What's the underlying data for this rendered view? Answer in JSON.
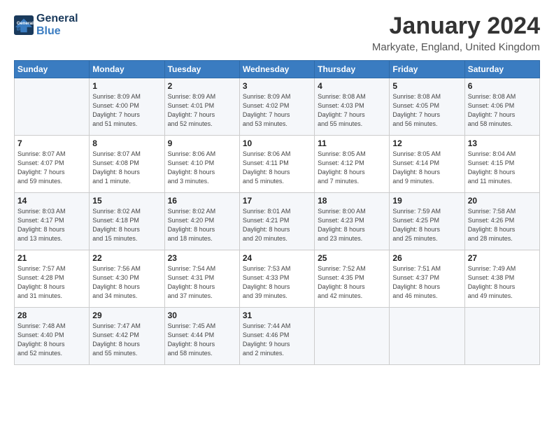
{
  "header": {
    "logo_line1": "General",
    "logo_line2": "Blue",
    "title": "January 2024",
    "location": "Markyate, England, United Kingdom"
  },
  "days_of_week": [
    "Sunday",
    "Monday",
    "Tuesday",
    "Wednesday",
    "Thursday",
    "Friday",
    "Saturday"
  ],
  "weeks": [
    [
      {
        "day": "",
        "info": ""
      },
      {
        "day": "1",
        "info": "Sunrise: 8:09 AM\nSunset: 4:00 PM\nDaylight: 7 hours\nand 51 minutes."
      },
      {
        "day": "2",
        "info": "Sunrise: 8:09 AM\nSunset: 4:01 PM\nDaylight: 7 hours\nand 52 minutes."
      },
      {
        "day": "3",
        "info": "Sunrise: 8:09 AM\nSunset: 4:02 PM\nDaylight: 7 hours\nand 53 minutes."
      },
      {
        "day": "4",
        "info": "Sunrise: 8:08 AM\nSunset: 4:03 PM\nDaylight: 7 hours\nand 55 minutes."
      },
      {
        "day": "5",
        "info": "Sunrise: 8:08 AM\nSunset: 4:05 PM\nDaylight: 7 hours\nand 56 minutes."
      },
      {
        "day": "6",
        "info": "Sunrise: 8:08 AM\nSunset: 4:06 PM\nDaylight: 7 hours\nand 58 minutes."
      }
    ],
    [
      {
        "day": "7",
        "info": "Sunrise: 8:07 AM\nSunset: 4:07 PM\nDaylight: 7 hours\nand 59 minutes."
      },
      {
        "day": "8",
        "info": "Sunrise: 8:07 AM\nSunset: 4:08 PM\nDaylight: 8 hours\nand 1 minute."
      },
      {
        "day": "9",
        "info": "Sunrise: 8:06 AM\nSunset: 4:10 PM\nDaylight: 8 hours\nand 3 minutes."
      },
      {
        "day": "10",
        "info": "Sunrise: 8:06 AM\nSunset: 4:11 PM\nDaylight: 8 hours\nand 5 minutes."
      },
      {
        "day": "11",
        "info": "Sunrise: 8:05 AM\nSunset: 4:12 PM\nDaylight: 8 hours\nand 7 minutes."
      },
      {
        "day": "12",
        "info": "Sunrise: 8:05 AM\nSunset: 4:14 PM\nDaylight: 8 hours\nand 9 minutes."
      },
      {
        "day": "13",
        "info": "Sunrise: 8:04 AM\nSunset: 4:15 PM\nDaylight: 8 hours\nand 11 minutes."
      }
    ],
    [
      {
        "day": "14",
        "info": "Sunrise: 8:03 AM\nSunset: 4:17 PM\nDaylight: 8 hours\nand 13 minutes."
      },
      {
        "day": "15",
        "info": "Sunrise: 8:02 AM\nSunset: 4:18 PM\nDaylight: 8 hours\nand 15 minutes."
      },
      {
        "day": "16",
        "info": "Sunrise: 8:02 AM\nSunset: 4:20 PM\nDaylight: 8 hours\nand 18 minutes."
      },
      {
        "day": "17",
        "info": "Sunrise: 8:01 AM\nSunset: 4:21 PM\nDaylight: 8 hours\nand 20 minutes."
      },
      {
        "day": "18",
        "info": "Sunrise: 8:00 AM\nSunset: 4:23 PM\nDaylight: 8 hours\nand 23 minutes."
      },
      {
        "day": "19",
        "info": "Sunrise: 7:59 AM\nSunset: 4:25 PM\nDaylight: 8 hours\nand 25 minutes."
      },
      {
        "day": "20",
        "info": "Sunrise: 7:58 AM\nSunset: 4:26 PM\nDaylight: 8 hours\nand 28 minutes."
      }
    ],
    [
      {
        "day": "21",
        "info": "Sunrise: 7:57 AM\nSunset: 4:28 PM\nDaylight: 8 hours\nand 31 minutes."
      },
      {
        "day": "22",
        "info": "Sunrise: 7:56 AM\nSunset: 4:30 PM\nDaylight: 8 hours\nand 34 minutes."
      },
      {
        "day": "23",
        "info": "Sunrise: 7:54 AM\nSunset: 4:31 PM\nDaylight: 8 hours\nand 37 minutes."
      },
      {
        "day": "24",
        "info": "Sunrise: 7:53 AM\nSunset: 4:33 PM\nDaylight: 8 hours\nand 39 minutes."
      },
      {
        "day": "25",
        "info": "Sunrise: 7:52 AM\nSunset: 4:35 PM\nDaylight: 8 hours\nand 42 minutes."
      },
      {
        "day": "26",
        "info": "Sunrise: 7:51 AM\nSunset: 4:37 PM\nDaylight: 8 hours\nand 46 minutes."
      },
      {
        "day": "27",
        "info": "Sunrise: 7:49 AM\nSunset: 4:38 PM\nDaylight: 8 hours\nand 49 minutes."
      }
    ],
    [
      {
        "day": "28",
        "info": "Sunrise: 7:48 AM\nSunset: 4:40 PM\nDaylight: 8 hours\nand 52 minutes."
      },
      {
        "day": "29",
        "info": "Sunrise: 7:47 AM\nSunset: 4:42 PM\nDaylight: 8 hours\nand 55 minutes."
      },
      {
        "day": "30",
        "info": "Sunrise: 7:45 AM\nSunset: 4:44 PM\nDaylight: 8 hours\nand 58 minutes."
      },
      {
        "day": "31",
        "info": "Sunrise: 7:44 AM\nSunset: 4:46 PM\nDaylight: 9 hours\nand 2 minutes."
      },
      {
        "day": "",
        "info": ""
      },
      {
        "day": "",
        "info": ""
      },
      {
        "day": "",
        "info": ""
      }
    ]
  ]
}
